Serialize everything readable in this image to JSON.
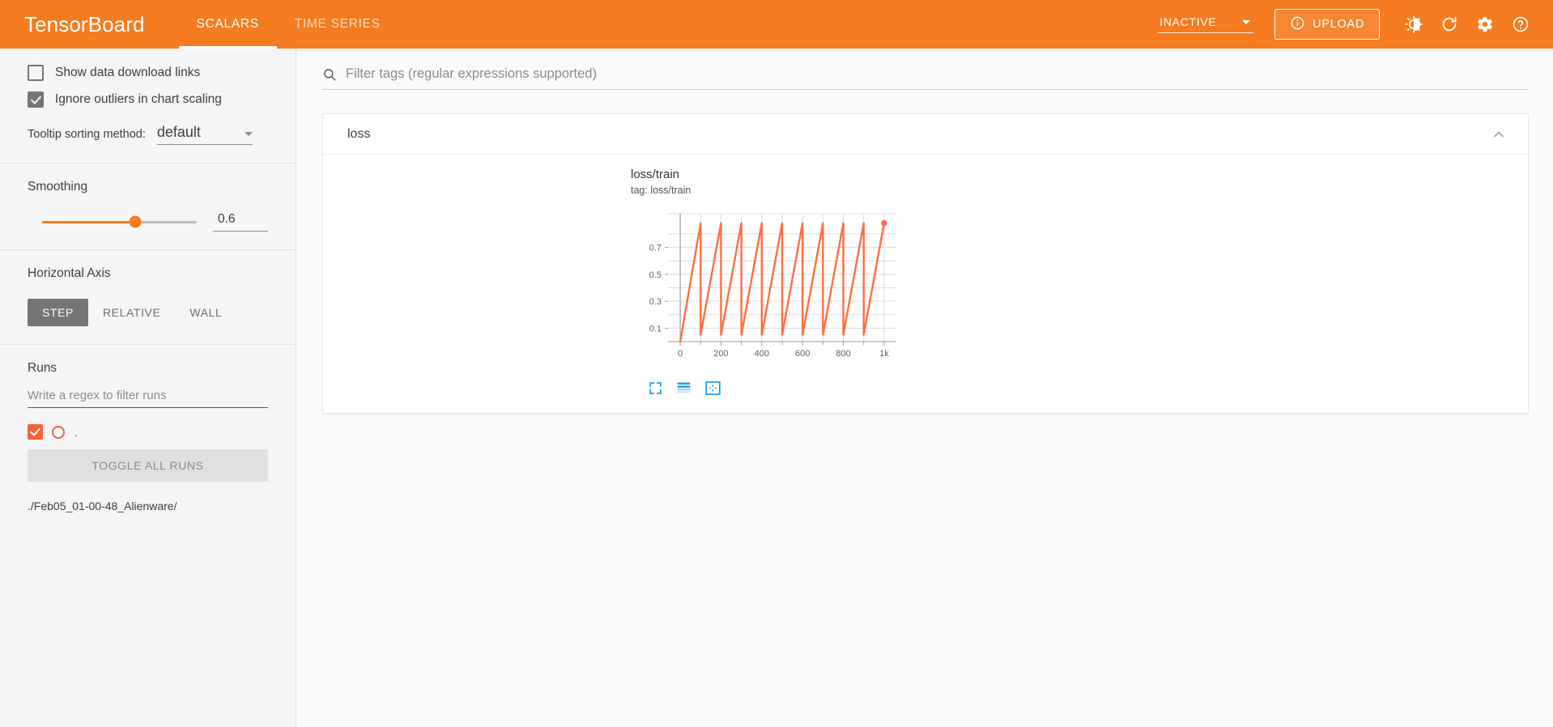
{
  "header": {
    "brand": "TensorBoard",
    "tabs": [
      {
        "label": "SCALARS",
        "active": true
      },
      {
        "label": "TIME SERIES",
        "active": false
      }
    ],
    "mode_select": {
      "value": "INACTIVE",
      "icon": "chevron-down-icon"
    },
    "upload_button": {
      "label": "UPLOAD",
      "icon": "info-circle-icon"
    },
    "icons": [
      "brightness-icon",
      "refresh-icon",
      "settings-gear-icon",
      "help-circle-icon"
    ],
    "background_color": "#F57C20"
  },
  "sidebar": {
    "checkboxes": [
      {
        "label": "Show data download links",
        "checked": false
      },
      {
        "label": "Ignore outliers in chart scaling",
        "checked": true
      }
    ],
    "tooltip_sorting": {
      "label": "Tooltip sorting method:",
      "value": "default"
    },
    "smoothing": {
      "title": "Smoothing",
      "value": "0.6",
      "percent": 60
    },
    "horizontal_axis": {
      "title": "Horizontal Axis",
      "options": [
        {
          "label": "STEP",
          "active": true
        },
        {
          "label": "RELATIVE",
          "active": false
        },
        {
          "label": "WALL",
          "active": false
        }
      ]
    },
    "runs": {
      "title": "Runs",
      "filter_placeholder": "Write a regex to filter runs",
      "items": [
        {
          "label": ".",
          "checked": true,
          "color": "#F4623A"
        }
      ],
      "toggle_all_label": "TOGGLE ALL RUNS",
      "path": "./Feb05_01-00-48_Alienware/"
    }
  },
  "main": {
    "filter": {
      "placeholder": "Filter tags (regular expressions supported)",
      "value": "",
      "icon": "search-icon"
    },
    "card": {
      "title": "loss",
      "collapse_icon": "chevron-up-icon",
      "chart": {
        "title": "loss/train",
        "subtitle": "tag: loss/train",
        "tools": [
          "expand-icon",
          "data-lines-icon",
          "fit-to-view-icon"
        ],
        "tools_color": "#1A9CF0"
      }
    }
  },
  "chart_data": {
    "type": "line",
    "title": "loss/train",
    "subtitle": "tag: loss/train",
    "xlabel": "",
    "ylabel": "",
    "series_name": "./Feb05_01-00-48_Alienware/",
    "color": "#FF6E42",
    "xlim": [
      -60,
      1060
    ],
    "ylim": [
      0.0,
      0.95
    ],
    "xticks": [
      0,
      200,
      400,
      600,
      800,
      1000
    ],
    "xtick_labels": [
      "0",
      "200",
      "400",
      "600",
      "800",
      "1k"
    ],
    "xminor_ticks": [
      100,
      300,
      500,
      700,
      900
    ],
    "yticks": [
      0.1,
      0.3,
      0.5,
      0.7
    ],
    "ytick_labels": [
      "0.1",
      "0.3",
      "0.5",
      "0.7"
    ],
    "yminor_ticks": [
      0.2,
      0.4,
      0.6,
      0.8
    ],
    "grid": true,
    "legend": false,
    "description": "Sawtooth waveform: 10 cycles of period 100 steps, rising from ~0.05 to ~0.88 then resetting.",
    "waveform": {
      "period": 100,
      "cycles": 10,
      "min": 0.05,
      "max": 0.88,
      "start": 0,
      "end": 1000
    },
    "marker_point": {
      "x": 1000,
      "y": 0.88
    },
    "x": [
      0,
      100,
      100,
      200,
      200,
      300,
      300,
      400,
      400,
      500,
      500,
      600,
      600,
      700,
      700,
      800,
      800,
      900,
      900,
      1000
    ],
    "y": [
      0.0,
      0.88,
      0.05,
      0.88,
      0.05,
      0.88,
      0.05,
      0.88,
      0.05,
      0.88,
      0.05,
      0.88,
      0.05,
      0.88,
      0.05,
      0.88,
      0.05,
      0.88,
      0.05,
      0.88
    ]
  }
}
